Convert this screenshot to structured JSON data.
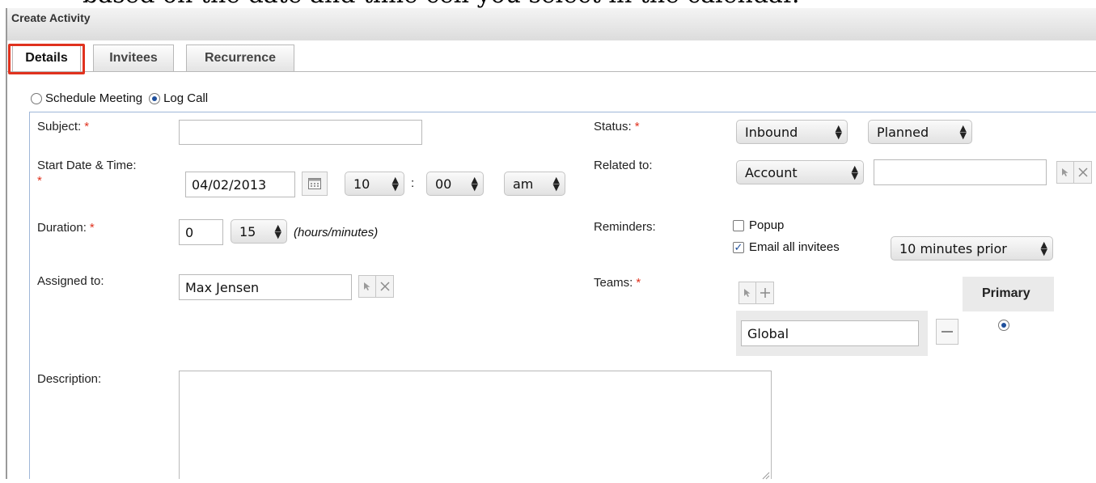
{
  "caption": "based on the date and time cell you select in the calendar.",
  "header": {
    "title": "Create Activity"
  },
  "tabs": [
    {
      "label": "Details",
      "active": true
    },
    {
      "label": "Invitees",
      "active": false
    },
    {
      "label": "Recurrence",
      "active": false
    }
  ],
  "activity_type": {
    "options": [
      {
        "label": "Schedule Meeting",
        "selected": false
      },
      {
        "label": "Log Call",
        "selected": true
      }
    ]
  },
  "form": {
    "required_mark": "*",
    "subject": {
      "label": "Subject:",
      "value": ""
    },
    "start": {
      "label": "Start Date & Time:",
      "date": "04/02/2013",
      "hour": "10",
      "separator": ":",
      "minute": "00",
      "meridiem": "am"
    },
    "duration": {
      "label": "Duration:",
      "hours": "0",
      "minutes": "15",
      "hint": "(hours/minutes)"
    },
    "assigned": {
      "label": "Assigned to:",
      "value": "Max Jensen"
    },
    "description": {
      "label": "Description:",
      "value": ""
    },
    "status": {
      "label": "Status:",
      "direction": "Inbound",
      "state": "Planned"
    },
    "related": {
      "label": "Related to:",
      "type": "Account",
      "value": ""
    },
    "reminders": {
      "label": "Reminders:",
      "popup": {
        "label": "Popup",
        "checked": false
      },
      "email": {
        "label": "Email all invitees",
        "checked": true,
        "timing": "10 minutes prior"
      }
    },
    "teams": {
      "label": "Teams:",
      "primary_header": "Primary",
      "team_name": "Global",
      "is_primary": true
    }
  },
  "colors": {
    "required": "#e0321e",
    "panel_border": "#9fb7d8",
    "highlight": "#e0321e",
    "accent": "#1e4f9c"
  }
}
